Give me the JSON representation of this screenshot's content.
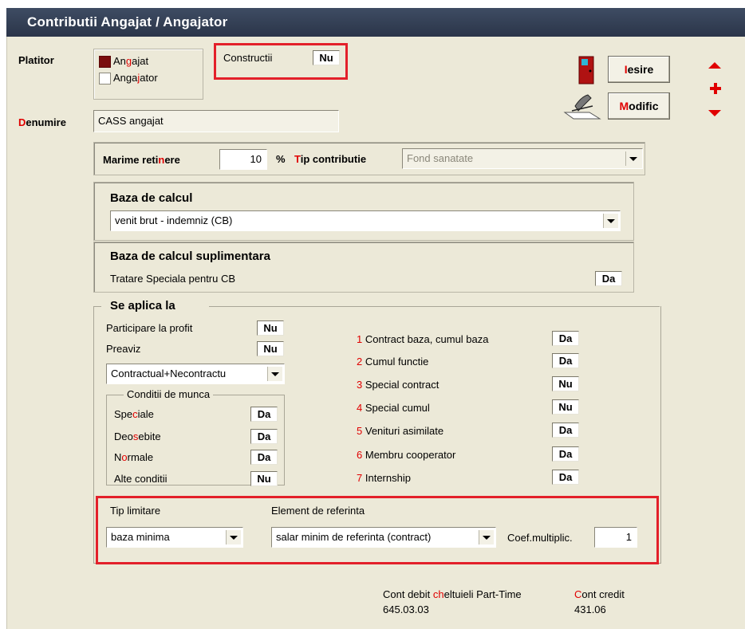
{
  "window_title": "Contributii Angajat / Angajator",
  "platitor": {
    "label": "Platitor",
    "option_angajat": "Angajat",
    "option_angajator": "Angajator",
    "constructii_label": "Constructii",
    "constructii_value": "Nu"
  },
  "buttons": {
    "iesire_first": "I",
    "iesire_rest": "esire",
    "modific_first": "M",
    "modific_rest": "odific"
  },
  "denumire": {
    "label_first": "D",
    "label_rest": "enumire",
    "value": "CASS angajat"
  },
  "marime": {
    "label_a": "Marime reti",
    "label_b": "n",
    "label_c": "ere",
    "value": "10",
    "unit": "%"
  },
  "tip_contributie": {
    "label_first": "T",
    "label_rest": "ip contributie",
    "value": "Fond sanatate"
  },
  "baza_calcul": {
    "title": "Baza de calcul",
    "value": "venit brut - indemniz (CB)"
  },
  "baza_supl": {
    "title": "Baza de calcul suplimentara",
    "item": "Tratare Speciala pentru CB",
    "value": "Da"
  },
  "se_aplica": {
    "title": "Se aplica la",
    "participare_label": "Participare la profit",
    "participare_value": "Nu",
    "preaviz_label": "Preaviz",
    "preaviz_value": "Nu",
    "preaviz_select": "Contractual+Necontractu",
    "conditii_title": "Conditii de munca",
    "conditii": [
      {
        "a": "Spe",
        "b": "c",
        "c": "iale",
        "value": "Da"
      },
      {
        "a": "Deo",
        "b": "s",
        "c": "ebite",
        "value": "Da"
      },
      {
        "a": "N",
        "b": "o",
        "c": "rmale",
        "value": "Da"
      },
      {
        "a": "Alte conditii",
        "b": "",
        "c": "",
        "value": "Nu"
      }
    ],
    "contracts": [
      {
        "num": "1",
        "label": "Contract baza, cumul baza",
        "value": "Da"
      },
      {
        "num": "2",
        "label": "Cumul functie",
        "value": "Da"
      },
      {
        "num": "3",
        "label": "Special contract",
        "value": "Nu"
      },
      {
        "num": "4",
        "label": "Special cumul",
        "value": "Nu"
      },
      {
        "num": "5",
        "label": "Venituri asimilate",
        "value": "Da"
      },
      {
        "num": "6",
        "label": "Membru cooperator",
        "value": "Da"
      },
      {
        "num": "7",
        "label": "Internship",
        "value": "Da"
      }
    ]
  },
  "limitare": {
    "tip_label": "Tip limitare",
    "tip_value": "baza minima",
    "element_label": "Element de referinta",
    "element_value": "salar minim de referinta (contract)",
    "coef_label": "Coef.multiplic.",
    "coef_value": "1"
  },
  "conturi": {
    "debit_label_a": "Cont debit ",
    "debit_label_b": "ch",
    "debit_label_c": "eltuieli Part-Time",
    "debit_value": "645.03.03",
    "credit_label_a": "C",
    "credit_label_b": "ont credit",
    "credit_value": "431.06"
  },
  "colors": {
    "accent_red": "#e00000",
    "highlight_box": "#e3202a",
    "title_bg": "#2f3a4f"
  }
}
